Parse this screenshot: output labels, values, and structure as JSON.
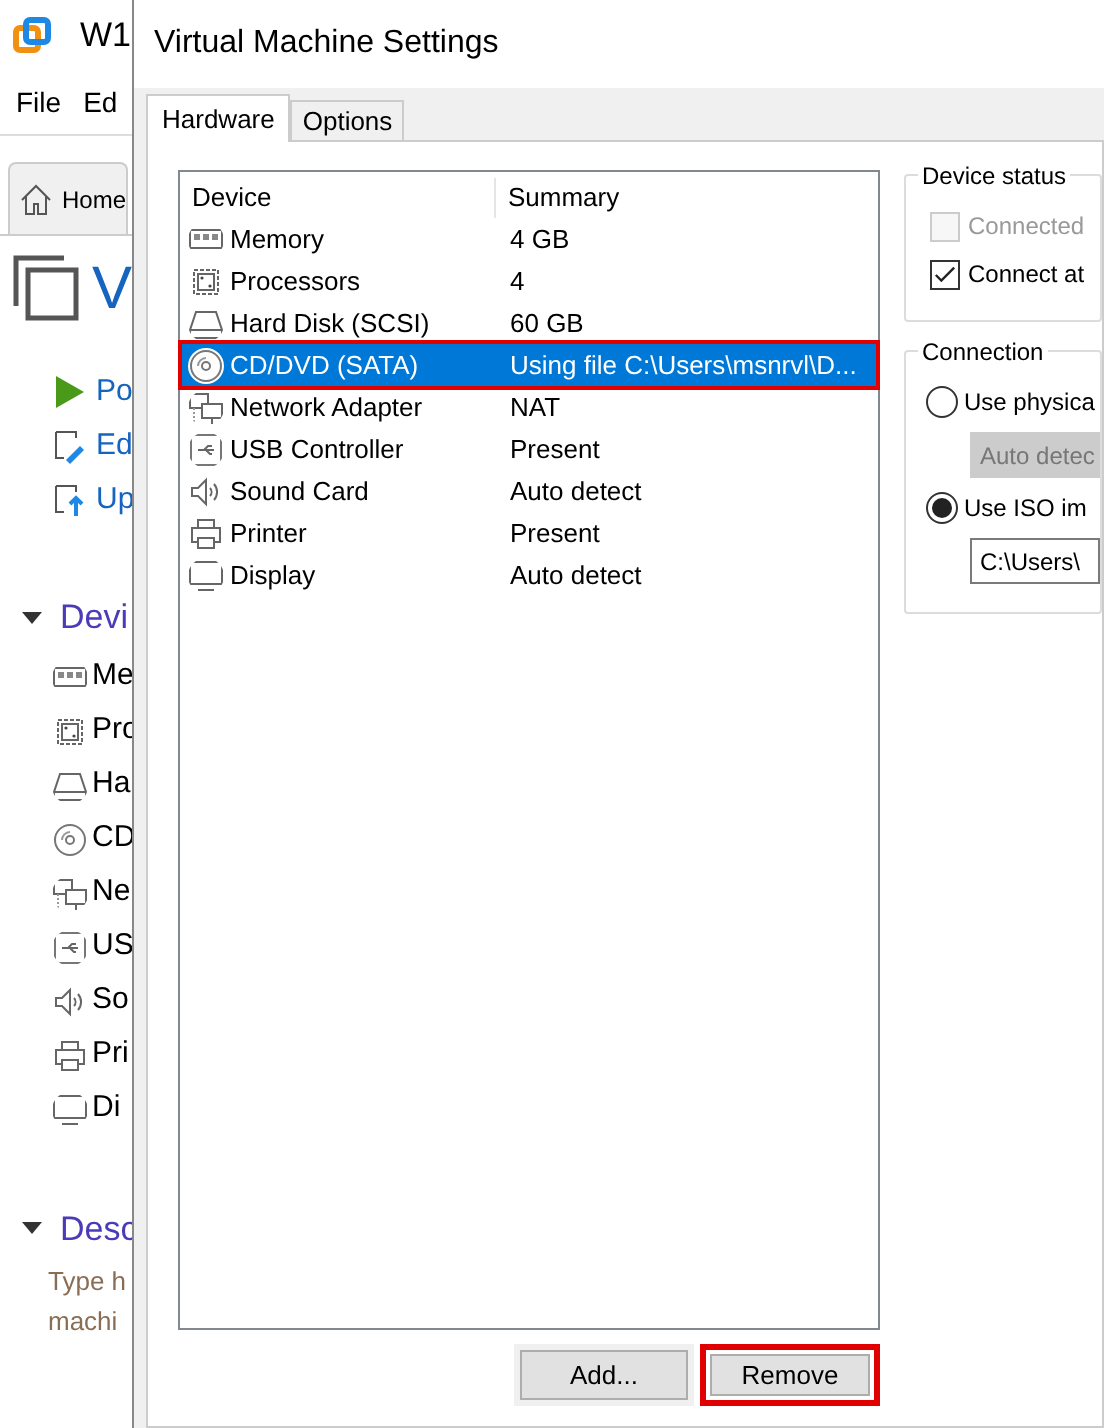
{
  "main_window": {
    "title": "W1",
    "menu": [
      "File",
      "Ed"
    ],
    "tab": "Home",
    "vm_name": "V",
    "actions": [
      {
        "label": "Po",
        "kind": "power"
      },
      {
        "label": "Ed",
        "kind": "edit"
      },
      {
        "label": "Up",
        "kind": "upgrade"
      }
    ],
    "devices_heading": "Devi",
    "devices": [
      {
        "label": "Me",
        "kind": "memory"
      },
      {
        "label": "Pro",
        "kind": "cpu"
      },
      {
        "label": "Ha",
        "kind": "disk"
      },
      {
        "label": "CD",
        "kind": "cd"
      },
      {
        "label": "Ne",
        "kind": "network"
      },
      {
        "label": "US",
        "kind": "usb"
      },
      {
        "label": "So",
        "kind": "sound"
      },
      {
        "label": "Pri",
        "kind": "printer"
      },
      {
        "label": "Di",
        "kind": "display"
      }
    ],
    "description_heading": "Desc",
    "description": [
      "Type h",
      "machi"
    ]
  },
  "dialog": {
    "title": "Virtual Machine Settings",
    "tabs": [
      {
        "label": "Hardware",
        "selected": true
      },
      {
        "label": "Options",
        "selected": false
      }
    ],
    "columns": [
      "Device",
      "Summary"
    ],
    "rows": [
      {
        "device": "Memory",
        "summary": "4 GB",
        "kind": "memory",
        "selected": false,
        "highlighted": false
      },
      {
        "device": "Processors",
        "summary": "4",
        "kind": "cpu",
        "selected": false,
        "highlighted": false
      },
      {
        "device": "Hard Disk (SCSI)",
        "summary": "60 GB",
        "kind": "disk",
        "selected": false,
        "highlighted": false
      },
      {
        "device": "CD/DVD (SATA)",
        "summary": "Using file C:\\Users\\msnrvl\\D...",
        "kind": "cd",
        "selected": true,
        "highlighted": true
      },
      {
        "device": "Network Adapter",
        "summary": "NAT",
        "kind": "network",
        "selected": false,
        "highlighted": false
      },
      {
        "device": "USB Controller",
        "summary": "Present",
        "kind": "usb",
        "selected": false,
        "highlighted": false
      },
      {
        "device": "Sound Card",
        "summary": "Auto detect",
        "kind": "sound",
        "selected": false,
        "highlighted": false
      },
      {
        "device": "Printer",
        "summary": "Present",
        "kind": "printer",
        "selected": false,
        "highlighted": false
      },
      {
        "device": "Display",
        "summary": "Auto detect",
        "kind": "display",
        "selected": false,
        "highlighted": false
      }
    ],
    "buttons": [
      {
        "label": "Add...",
        "highlighted": false
      },
      {
        "label": "Remove",
        "highlighted": true
      }
    ],
    "device_status": {
      "title": "Device status",
      "options": [
        {
          "label": "Connected",
          "checked": false,
          "disabled": true
        },
        {
          "label": "Connect at",
          "checked": true,
          "disabled": false
        }
      ]
    },
    "connection": {
      "title": "Connection",
      "physical": {
        "label": "Use physica",
        "selected": false,
        "dropdown": "Auto detec"
      },
      "iso": {
        "label": "Use ISO im",
        "selected": true,
        "path": "C:\\Users\\"
      }
    }
  }
}
